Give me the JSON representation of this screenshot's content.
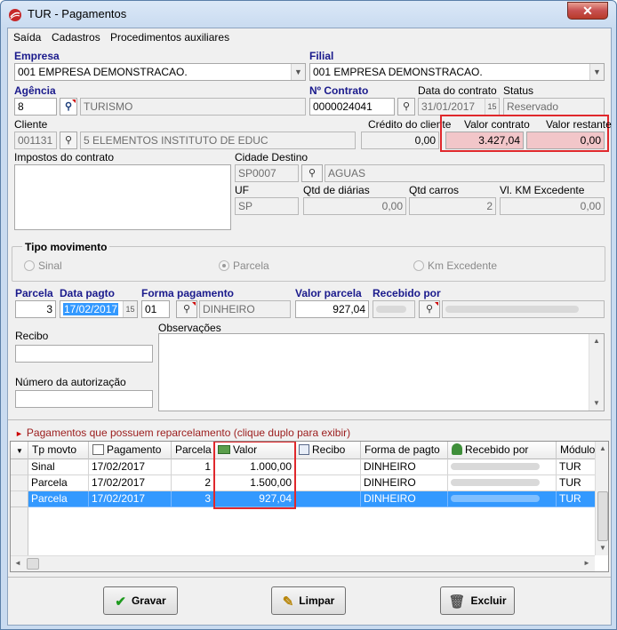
{
  "window": {
    "title": "TUR - Pagamentos",
    "close_glyph": "✕"
  },
  "menu": [
    "Saída",
    "Cadastros",
    "Procedimentos auxiliares"
  ],
  "form": {
    "empresa": {
      "label": "Empresa",
      "value": "001 EMPRESA DEMONSTRACAO."
    },
    "filial": {
      "label": "Filial",
      "value": "001 EMPRESA DEMONSTRACAO."
    },
    "agencia": {
      "label": "Agência",
      "code": "8",
      "name": "TURISMO"
    },
    "contrato": {
      "label": "Nº Contrato",
      "value": "0000024041"
    },
    "data_contrato": {
      "label": "Data do contrato",
      "value": "31/01/2017"
    },
    "status": {
      "label": "Status",
      "value": "Reservado"
    },
    "cliente": {
      "label": "Cliente",
      "code": "001131",
      "name": "5 ELEMENTOS INSTITUTO DE EDUC"
    },
    "credito_cliente": {
      "label": "Crédito do cliente",
      "value": "0,00"
    },
    "valor_contrato": {
      "label": "Valor contrato",
      "value": "3.427,04"
    },
    "valor_restante": {
      "label": "Valor restante",
      "value": "0,00"
    },
    "impostos": {
      "label": "Impostos do contrato"
    },
    "cidade_destino": {
      "label": "Cidade Destino",
      "code": "SP0007",
      "name": "AGUAS"
    },
    "uf": {
      "label": "UF",
      "value": "SP"
    },
    "qtd_diarias": {
      "label": "Qtd de diárias",
      "value": "0,00"
    },
    "qtd_carros": {
      "label": "Qtd carros",
      "value": "2"
    },
    "vl_km": {
      "label": "Vl. KM Excedente",
      "value": "0,00"
    },
    "tipo_movimento": {
      "label": "Tipo movimento",
      "options": [
        "Sinal",
        "Parcela",
        "Km Excedente"
      ],
      "selected": "Parcela"
    },
    "parcela": {
      "label": "Parcela",
      "value": "3"
    },
    "data_pagto": {
      "label": "Data pagto",
      "value": "17/02/2017"
    },
    "forma_pagamento": {
      "label": "Forma pagamento",
      "code": "01",
      "name": "DINHEIRO"
    },
    "valor_parcela": {
      "label": "Valor parcela",
      "value": "927,04"
    },
    "recebido_por": {
      "label": "Recebido por"
    },
    "recibo": {
      "label": "Recibo",
      "value": ""
    },
    "observacoes": {
      "label": "Observações",
      "value": ""
    },
    "autorizacao": {
      "label": "Número da autorização",
      "value": ""
    }
  },
  "grid": {
    "caption": "Pagamentos que possuem reparcelamento (clique duplo para exibir)",
    "columns": [
      "Tp movto",
      "Pagamento",
      "Parcela",
      "Valor",
      "Recibo",
      "Forma de pagto",
      "Recebido por",
      "Módulo"
    ],
    "rows": [
      {
        "tp": "Sinal",
        "pagamento": "17/02/2017",
        "parcela": "1",
        "valor": "1.000,00",
        "recibo": "",
        "forma": "DINHEIRO",
        "modulo": "TUR"
      },
      {
        "tp": "Parcela",
        "pagamento": "17/02/2017",
        "parcela": "2",
        "valor": "1.500,00",
        "recibo": "",
        "forma": "DINHEIRO",
        "modulo": "TUR"
      },
      {
        "tp": "Parcela",
        "pagamento": "17/02/2017",
        "parcela": "3",
        "valor": "927,04",
        "recibo": "",
        "forma": "DINHEIRO",
        "modulo": "TUR"
      }
    ],
    "selected_row": 2
  },
  "buttons": {
    "gravar": "Gravar",
    "limpar": "Limpar",
    "excluir": "Excluir"
  },
  "colors": {
    "accent": "#3399ff",
    "highlight_border": "#e0282c",
    "pink_field": "#f2c6c9",
    "label_blue": "#1a1a8c"
  }
}
